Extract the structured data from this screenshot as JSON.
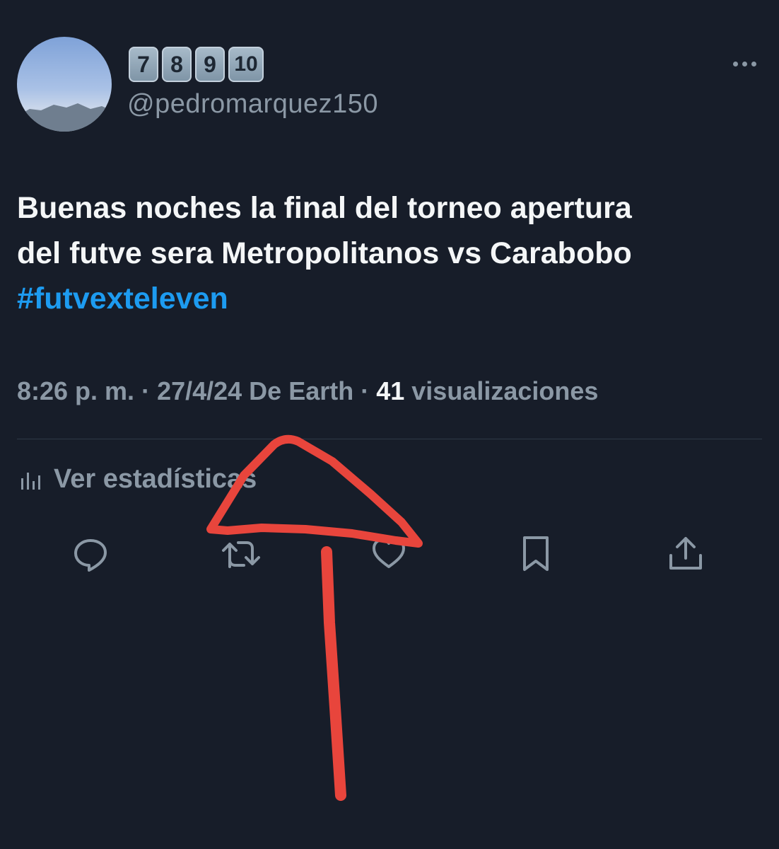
{
  "author": {
    "display_name_badges": [
      "7",
      "8",
      "9",
      "10"
    ],
    "handle": "@pedromarquez150"
  },
  "tweet": {
    "text_lines": [
      "Buenas noches la final del torneo apertura",
      "del futve sera Metropolitanos vs Carabobo"
    ],
    "hashtag": "#futvexteleven"
  },
  "meta": {
    "time": "8:26 p. m.",
    "separator": " · ",
    "date_source": "27/4/24 De Earth",
    "views_count": "41",
    "views_label": " visualizaciones"
  },
  "stats_link": {
    "label": "Ver estadísticas"
  },
  "actions": [
    {
      "name": "reply",
      "icon": "reply-icon"
    },
    {
      "name": "retweet",
      "icon": "retweet-icon"
    },
    {
      "name": "like",
      "icon": "heart-icon"
    },
    {
      "name": "bookmark",
      "icon": "bookmark-icon"
    },
    {
      "name": "share",
      "icon": "share-icon"
    }
  ],
  "colors": {
    "background": "#171d29",
    "text": "#e7e9ea",
    "muted": "#8b98a5",
    "hashtag": "#1d9bf0",
    "annotation": "#e8453c"
  }
}
